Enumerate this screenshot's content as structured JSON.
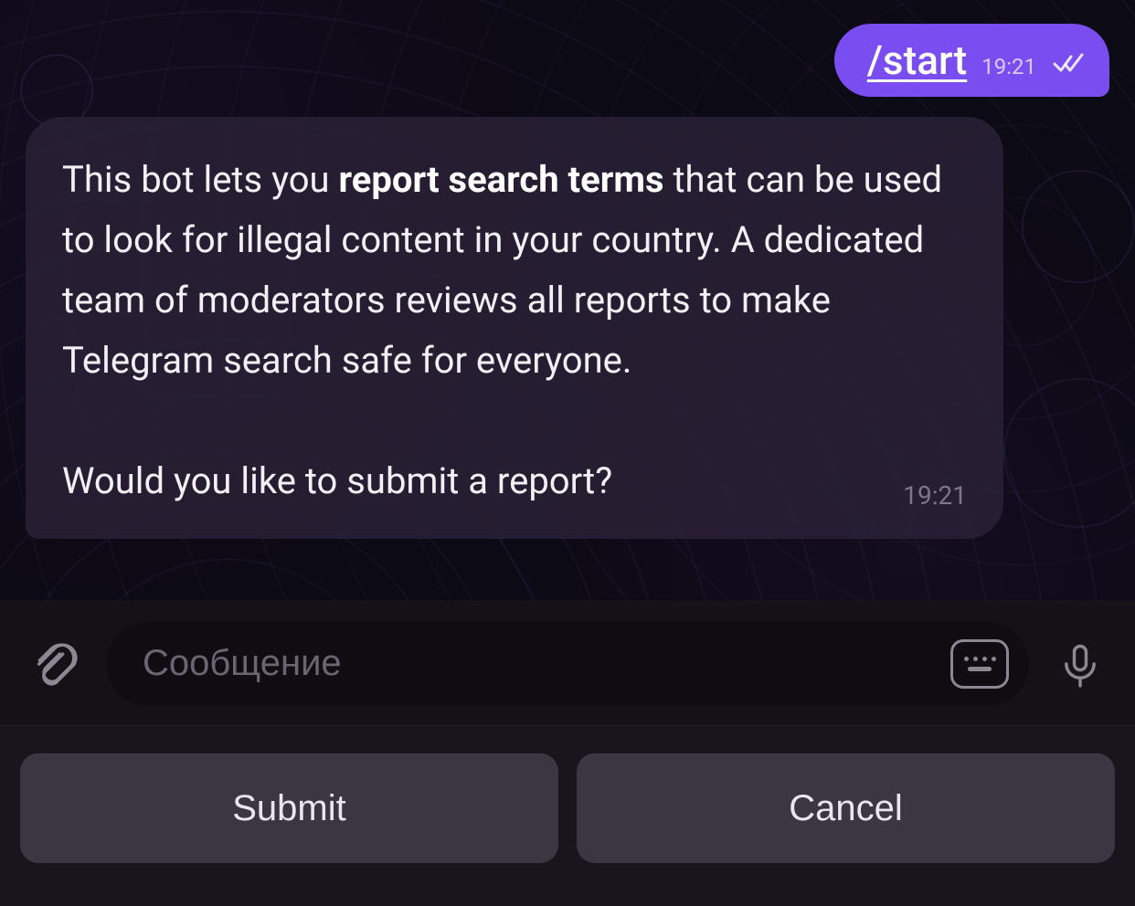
{
  "messages": {
    "outgoing": {
      "text": "/start",
      "time": "19:21",
      "status": "read"
    },
    "incoming": {
      "prefix": "This bot lets you ",
      "bold": "report search terms",
      "rest": " that can be used to look for illegal content in your country. A dedicated team of moderators reviews all reports to make Telegram search safe for everyone.",
      "paragraph2": "Would you like to submit a report?",
      "time": "19:21"
    }
  },
  "composer": {
    "placeholder": "Сообщение"
  },
  "reply_keyboard": {
    "buttons": [
      "Submit",
      "Cancel"
    ]
  }
}
